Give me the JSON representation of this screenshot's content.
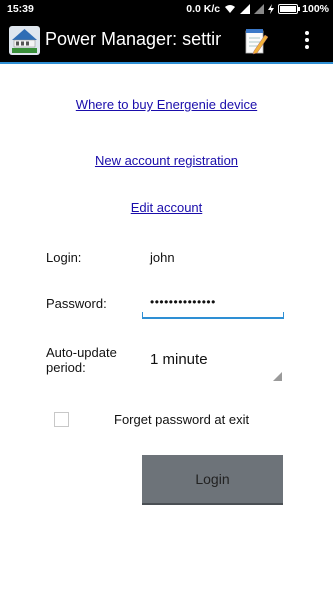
{
  "status_bar": {
    "time": "15:39",
    "network_speed": "0.0 K/c",
    "battery_percent": "100%",
    "battery_level": 1.0
  },
  "action_bar": {
    "title": "Power Manager: settings",
    "app_icon": "power-manager-app-icon",
    "edit_icon": "notepad-pencil-icon",
    "overflow_icon": "vertical-dots-icon"
  },
  "links": {
    "buy": "Where to buy Energenie device",
    "register": "New account registration",
    "edit": "Edit account"
  },
  "form": {
    "login_label": "Login:",
    "login_value": "john",
    "password_label": "Password:",
    "password_value": "••••••••••••••",
    "update_label": "Auto-update\nperiod:",
    "update_value": "1 minute",
    "forget_label": "Forget password at exit",
    "forget_checked": false,
    "login_button": "Login"
  },
  "colors": {
    "accent": "#2e8fd4",
    "link": "#1a0dab",
    "button": "#6d7379"
  }
}
